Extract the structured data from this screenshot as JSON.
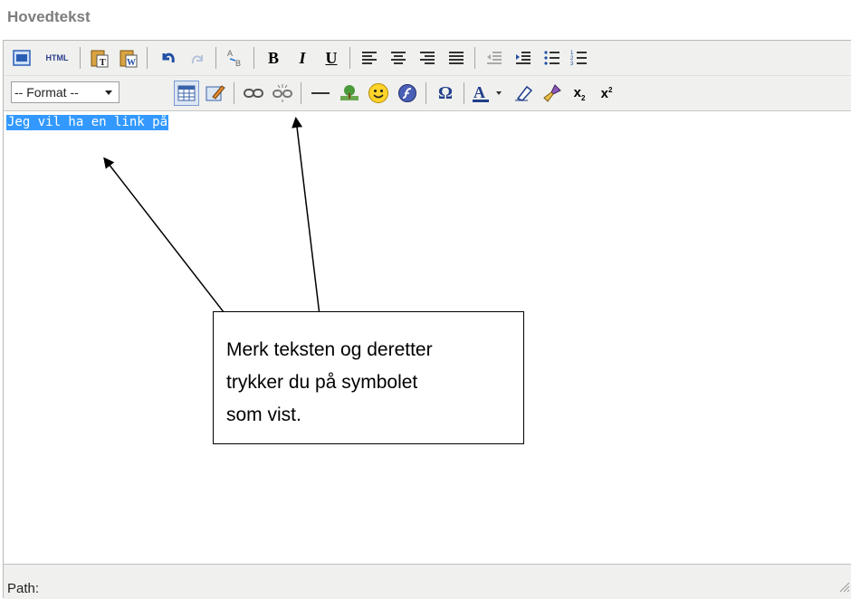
{
  "heading": "Hovedtekst",
  "toolbar": {
    "format_select": "-- Format --",
    "html_label": "HTML"
  },
  "editor": {
    "selected_text": "Jeg vil ha en link på"
  },
  "statusbar": {
    "path_label": "Path:"
  },
  "callout": {
    "line1": "Merk teksten og deretter",
    "line2": "trykker du på symbolet",
    "line3": "som vist."
  },
  "colors": {
    "toolbar_bg": "#f0f0ee",
    "selection": "#3399ff",
    "heading": "#7d7d7d"
  }
}
